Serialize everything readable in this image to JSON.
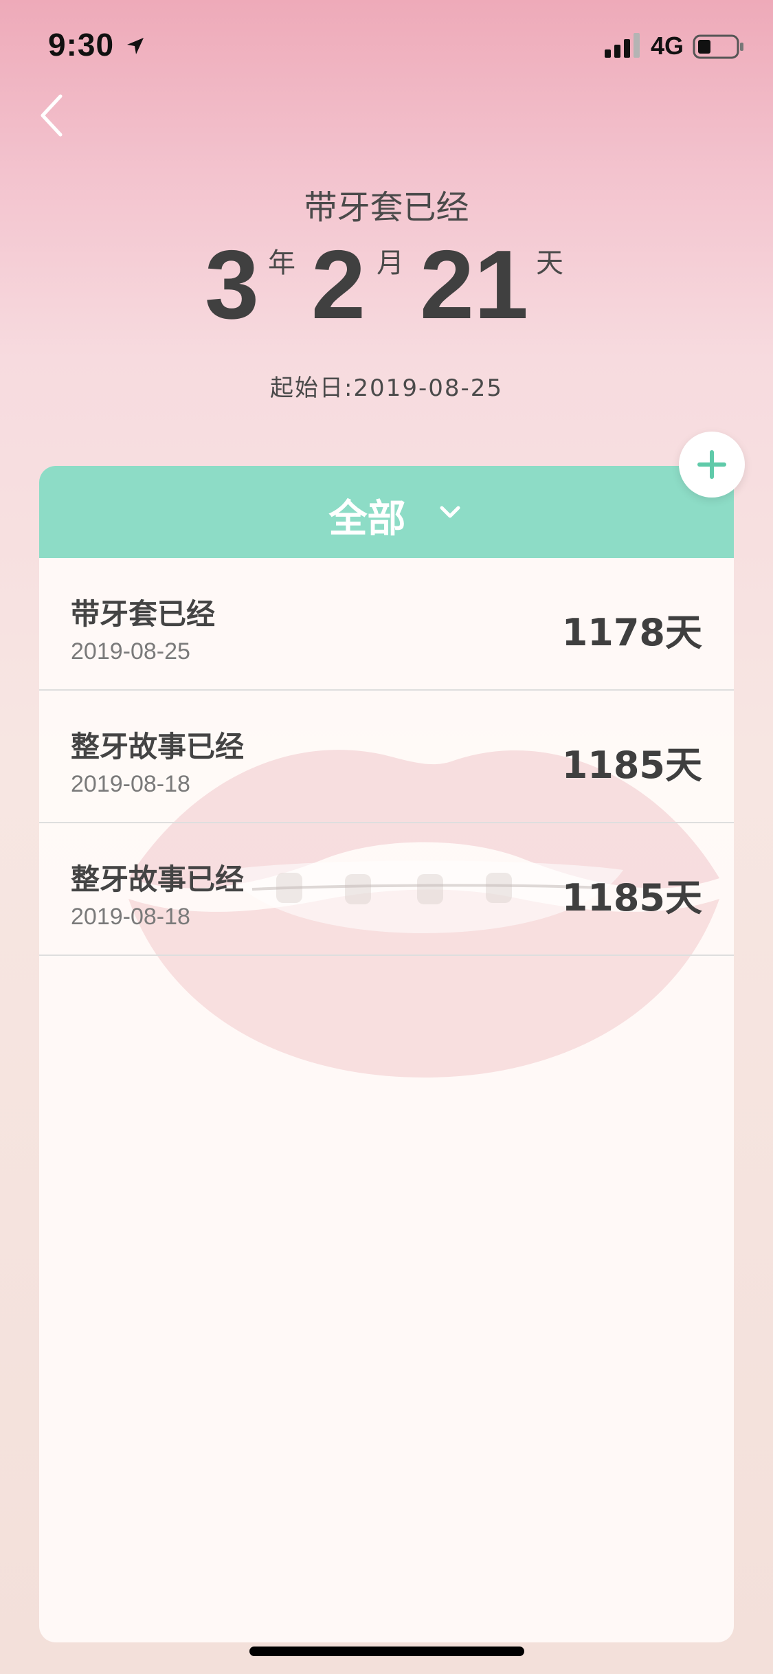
{
  "status_bar": {
    "time": "9:30",
    "network": "4G",
    "icons": [
      "location-arrow-icon",
      "cellular-signal-icon",
      "battery-icon"
    ]
  },
  "header": {
    "back_icon": "chevron-left-icon",
    "title": "带牙套已经",
    "duration": {
      "years": "3",
      "years_unit": "年",
      "months": "2",
      "months_unit": "月",
      "days": "21",
      "days_unit": "天"
    },
    "start_date": "起始日:2019-08-25"
  },
  "filter": {
    "label": "全部",
    "icon": "chevron-down-icon"
  },
  "add_button": {
    "icon": "plus-icon"
  },
  "list": [
    {
      "title": "带牙套已经",
      "date": "2019-08-25",
      "days": "1178天"
    },
    {
      "title": "整牙故事已经",
      "date": "2019-08-18",
      "days": "1185天"
    },
    {
      "title": "整牙故事已经",
      "date": "2019-08-18",
      "days": "1185天"
    }
  ],
  "colors": {
    "accent": "#8ddcc6",
    "plus": "#5fcaa9",
    "text": "#404040"
  }
}
